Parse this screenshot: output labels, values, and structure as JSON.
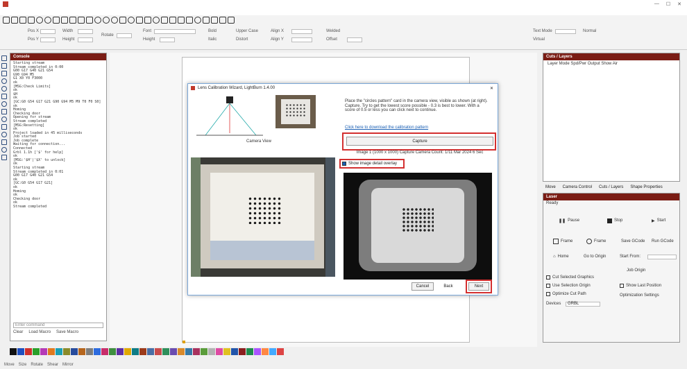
{
  "window": {
    "app_icon": "lightburn-app-icon",
    "min_icon": "minimize-icon",
    "max_icon": "maximize-icon",
    "close_icon": "close-icon"
  },
  "dialog": {
    "title": "Lens Calibration Wizard, LightBurn 1.4.00",
    "instructions": "Place the \"circles pattern\" card in the camera view, visible as shown (at right). Capture. Try to get the lowest score possible - 0.3 is best to lower. With a score of 0.5 or less you can click next to continue.",
    "link": "Click here to download the calibration pattern",
    "capture_label": "Capture",
    "status_line": "Image 1 (1000 x 1000)  Capture Camera Count: 1/11   Mar 2024  6 Sec",
    "checkbox_label": "Show image detail overlay",
    "camera_view_label": "Camera View",
    "cancel_label": "Cancel",
    "back_label": "Back",
    "next_label": "Next"
  },
  "panels": {
    "console_title": "Console",
    "cut_layers_title": "Cuts / Layers",
    "cut_layers_header": "Layer   Mode   Spd/Pwr   Output   Show   Air",
    "laser_title": "Laser",
    "laser_subtitle": "Ready",
    "tabs": [
      "Move",
      "Camera Control",
      "Cuts / Layers",
      "Shape Properties"
    ],
    "laser_buttons": {
      "pause": "Pause",
      "stop": "Stop",
      "start": "Start",
      "frame": "Frame",
      "frame2": "Frame",
      "save_gcode": "Save GCode",
      "run_gcode": "Run GCode",
      "home": "Home",
      "go_to_origin": "Go to Origin",
      "start_from": "Start From:",
      "job_origin": "Job Origin",
      "cut_selected": "Cut Selected Graphics",
      "use_selection_origin": "Use Selection Origin",
      "show_last_position": "Show Last Position",
      "optimize_cut_path": "Optimize Cut Path",
      "optimization_settings": "Optimization Settings",
      "devices_label": "Devices",
      "devices_value": "GRBL"
    }
  },
  "console_lines": [
    "Starting stream",
    "Stream completed in 0:00",
    "G00 G17 G40 G21 G54",
    "G90 G94 M5",
    "G1 X0 Y0 F3000",
    "ok",
    "[MSG:Check Limits]",
    "ok",
    "$H",
    "ok",
    "[GC:G0 G54 G17 G21 G90 G94 M5 M9 T0 F0 S0]",
    "ok",
    "Homing",
    "Checking door",
    "Opening for stream",
    "Stream completed",
    "[MSG:Resetting]",
    "ok",
    "Project loaded in 45 milliseconds",
    "Job started",
    "Job complete",
    "Waiting for connection...",
    "Connected",
    "Grbl 1.1h ['$' for help]",
    "ok",
    "[MSG:'$H'|'$X' to unlock]",
    "ok",
    "Starting stream",
    "Stream completed in 0:01",
    "G00 G17 G40 G21 G54",
    "ok",
    "[GC:G0 G54 G17 G21]",
    "ok",
    "Homing",
    "ok",
    "Checking door",
    "ok",
    "Stream completed"
  ],
  "console_input_label": "Enter command",
  "console_buttons": [
    "Clear",
    "Load Macro",
    "Save Macro"
  ],
  "toolbar": {
    "row2_labels": [
      "Pos X",
      "Pos Y",
      "Width",
      "Height",
      "Rotate",
      "Font",
      "Height",
      "Bold",
      "Italic",
      "Upper Case",
      "Distort",
      "Align X",
      "Align Y",
      "Welded",
      "Offset"
    ],
    "right_labels": [
      "Text Mode",
      "Normal",
      "Virtual"
    ]
  },
  "palette_colors": [
    "#111111",
    "#1f4fbf",
    "#d0302b",
    "#2aa02a",
    "#b53ab6",
    "#e07a1f",
    "#1a9fb5",
    "#8a8a2a",
    "#274b9c",
    "#b5651d",
    "#7d7d7d",
    "#2d6cdf",
    "#c82d6a",
    "#3f8f3f",
    "#5d2fa3",
    "#e0a800",
    "#0e7c86",
    "#9c3b1b",
    "#4a6fa5",
    "#c94c4c",
    "#2f8f5b",
    "#6a4caf",
    "#d98a2b",
    "#3579a8",
    "#a8325e",
    "#5a9c3a",
    "#b3b3b3",
    "#de4aa3",
    "#e0c020",
    "#2255aa",
    "#8b1e1e",
    "#1e8b4c",
    "#aa55ff",
    "#ff8844",
    "#44aaff",
    "#dd4444"
  ],
  "status": [
    "Move",
    "Size",
    "Rotate",
    "Shear",
    "Mirror"
  ]
}
